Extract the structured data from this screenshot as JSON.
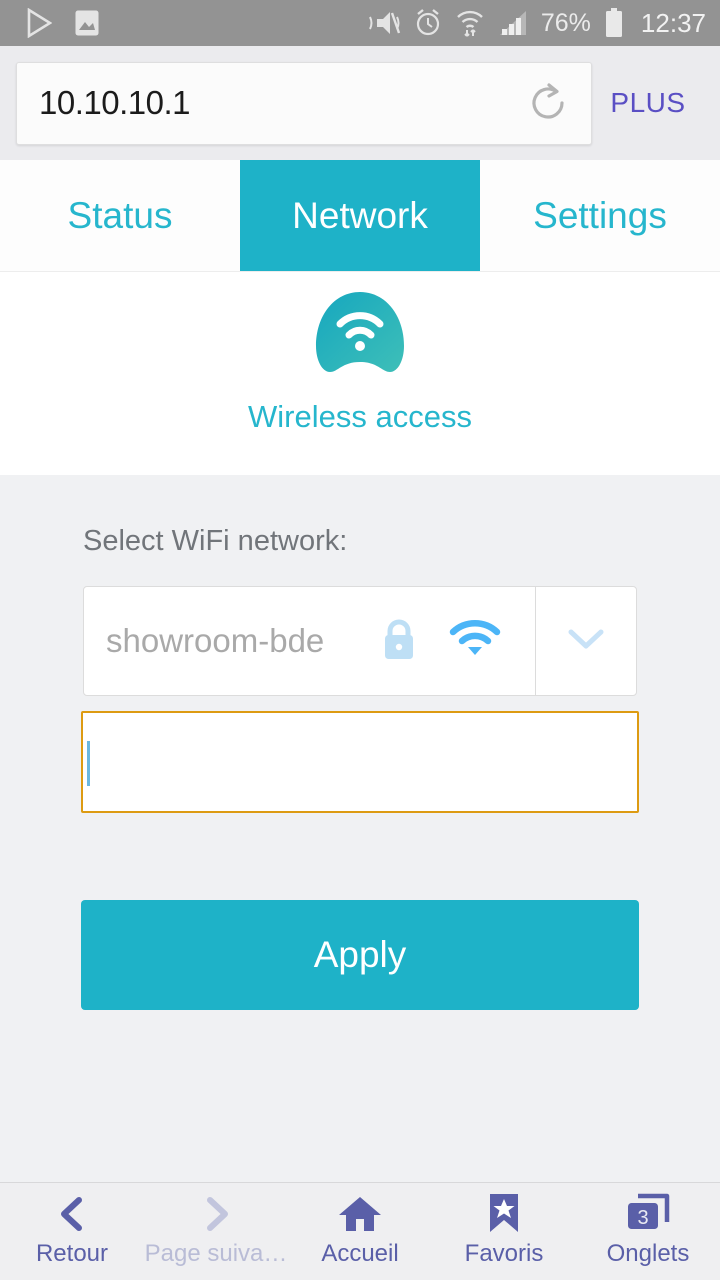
{
  "status_bar": {
    "icons_left": [
      "play-icon",
      "image-icon"
    ],
    "icons_right": [
      "mute-vibrate-icon",
      "alarm-icon",
      "wifi-transfer-icon",
      "cellular-signal-icon"
    ],
    "battery_percent": "76%",
    "time": "12:37"
  },
  "browser": {
    "url": "10.10.10.1",
    "reload_icon": "reload-icon",
    "menu_label": "PLUS"
  },
  "tabs": [
    {
      "label": "Status",
      "active": false
    },
    {
      "label": "Network",
      "active": true
    },
    {
      "label": "Settings",
      "active": false
    }
  ],
  "hero": {
    "icon": "wireless-dome-icon",
    "title": "Wireless access"
  },
  "form": {
    "select_label": "Select WiFi network:",
    "network_value": "showroom-bde",
    "lock_icon": "lock-icon",
    "signal_icon": "wifi-signal-icon",
    "dropdown_icon": "chevron-down-icon",
    "password_value": "",
    "password_placeholder": "",
    "apply_label": "Apply"
  },
  "bottom_nav": [
    {
      "label": "Retour",
      "icon": "chevron-left-icon",
      "disabled": false
    },
    {
      "label": "Page suiva…",
      "icon": "chevron-right-icon",
      "disabled": true
    },
    {
      "label": "Accueil",
      "icon": "home-icon",
      "disabled": false
    },
    {
      "label": "Favoris",
      "icon": "bookmark-star-icon",
      "disabled": false
    },
    {
      "label": "Onglets",
      "icon": "tabs-icon",
      "disabled": false,
      "count": "3"
    }
  ],
  "colors": {
    "accent_teal": "#1eb2c8",
    "tab_text": "#26b6cd",
    "focus_orange": "#dd9b12",
    "nav_purple": "#5a5fa8",
    "plus_purple": "#5a4fc4",
    "panel_bg": "#f0f1f3"
  }
}
